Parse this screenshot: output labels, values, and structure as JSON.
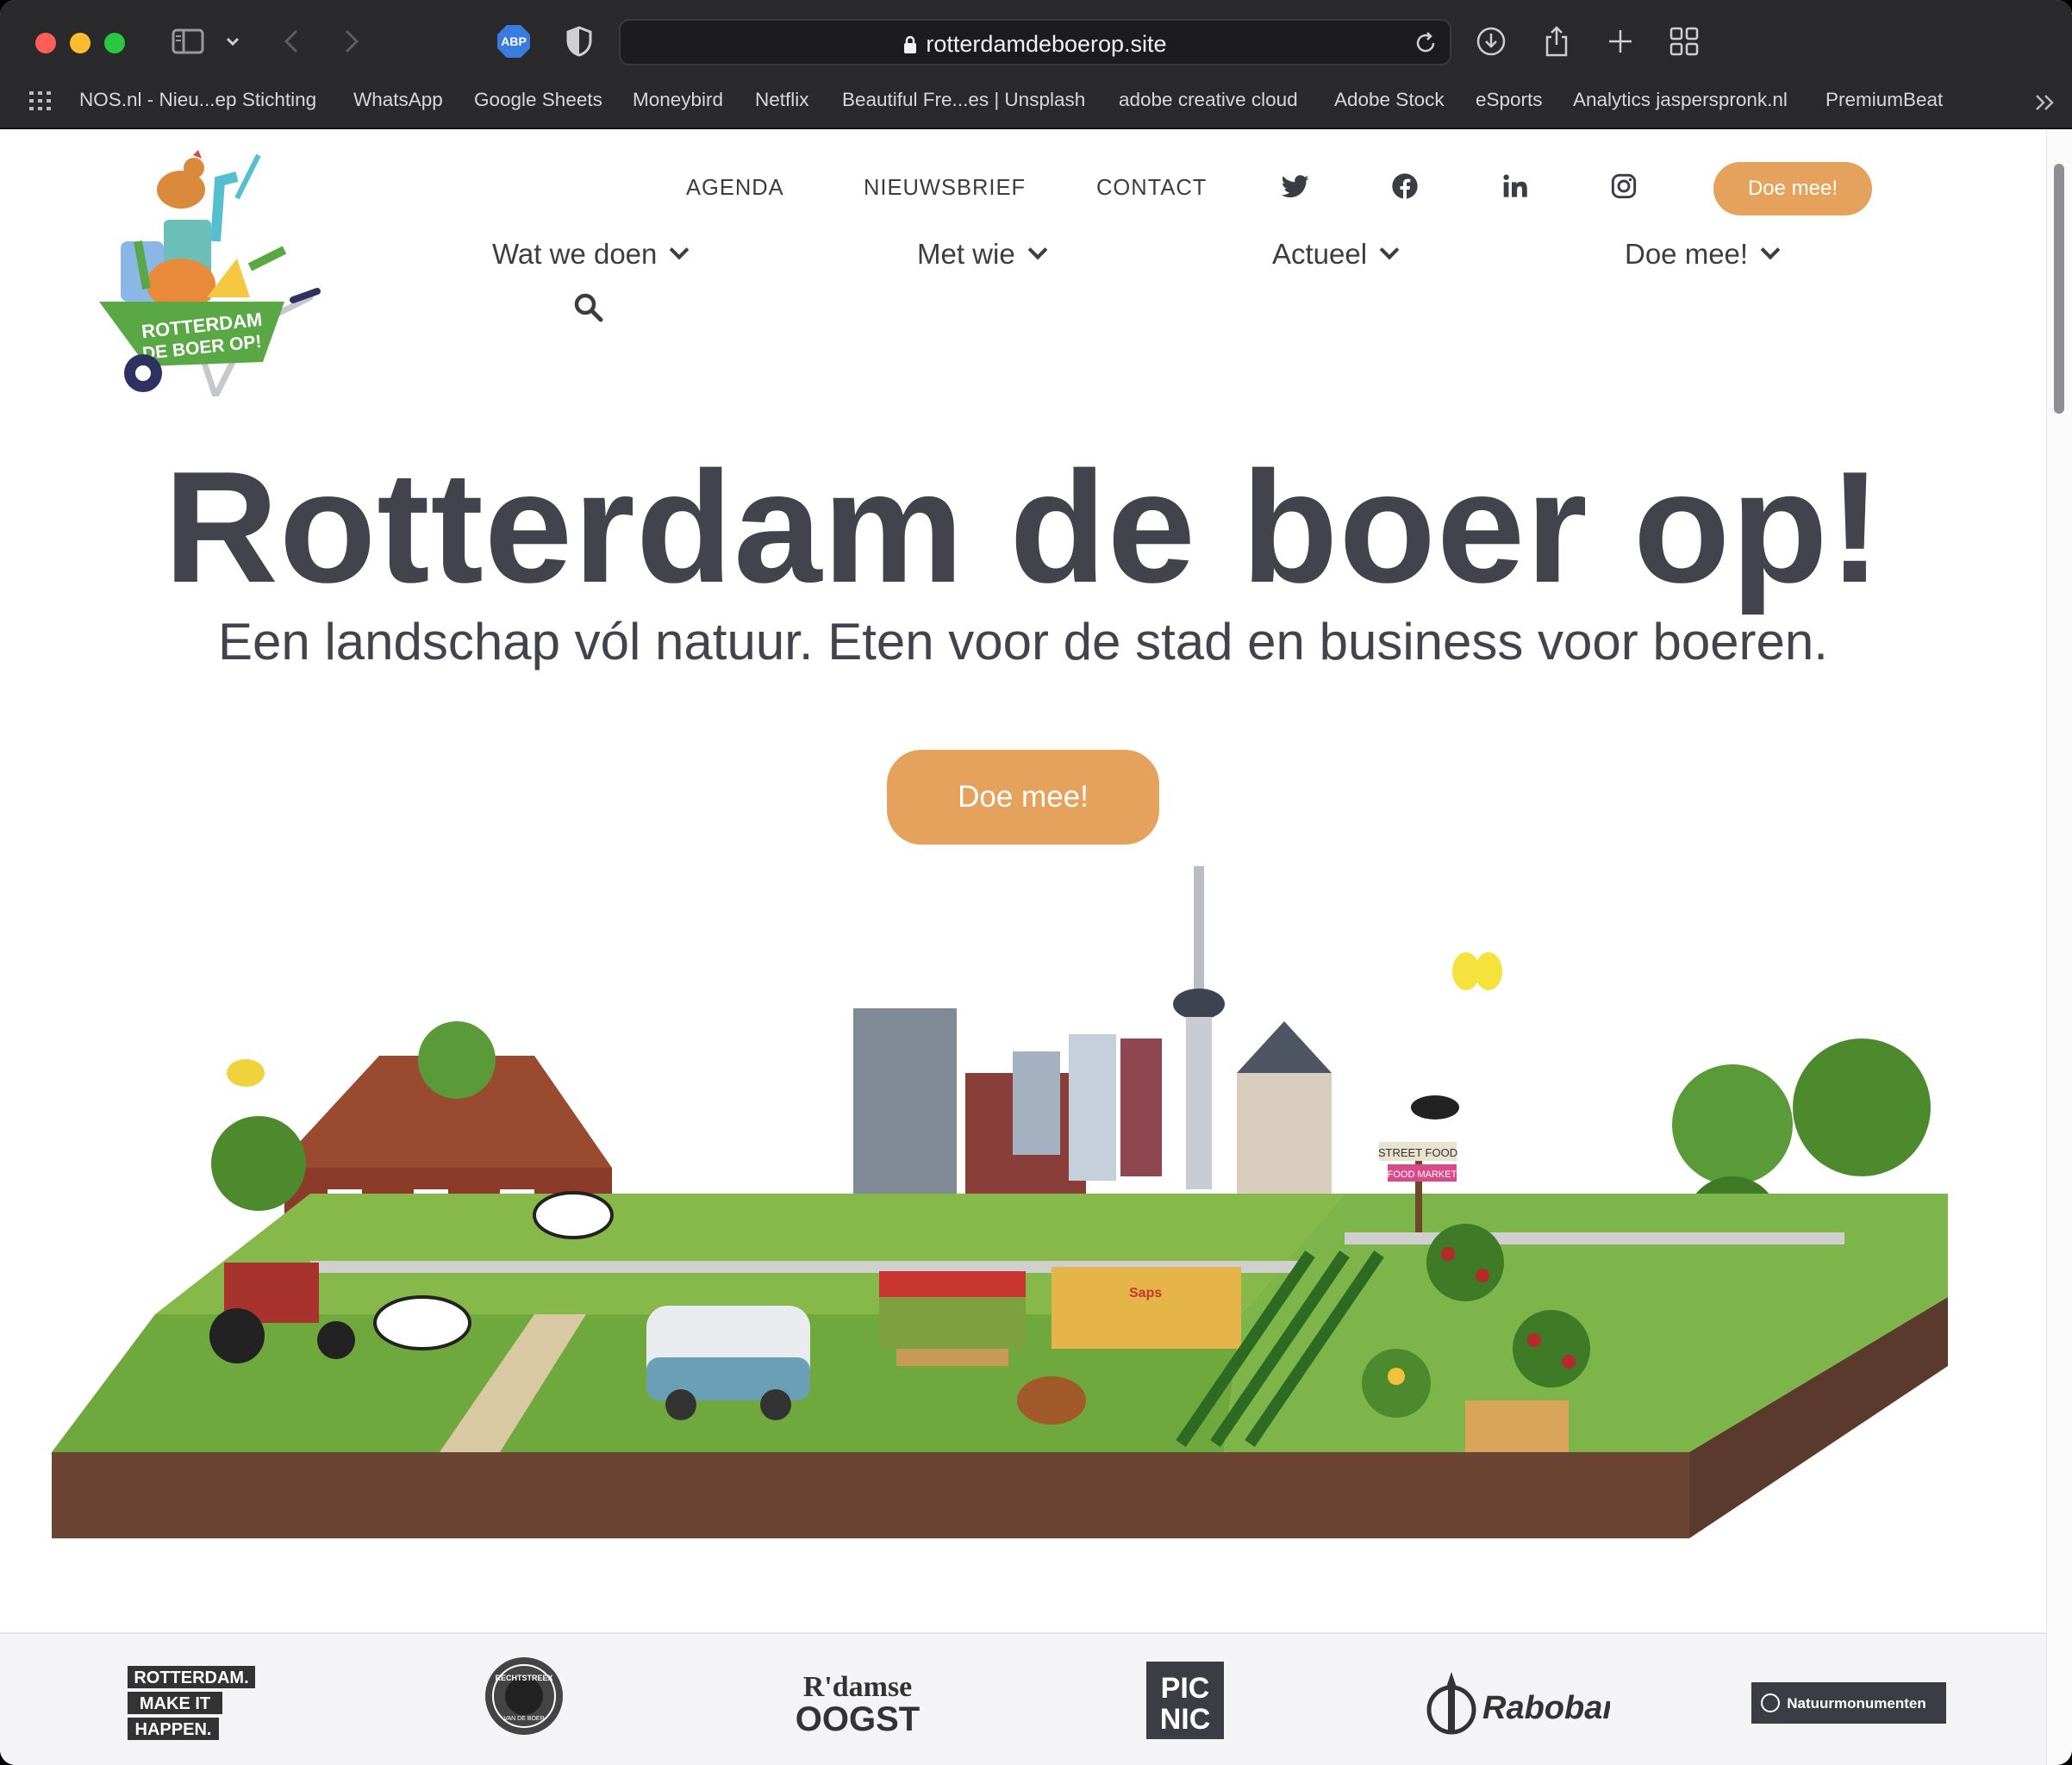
{
  "browser": {
    "url": "rotterdamdeboerop.site",
    "adblock_label": "ABP",
    "bookmarks": [
      "NOS.nl - Nieu...ep Stichting",
      "WhatsApp",
      "Google Sheets",
      "Moneybird",
      "Netflix",
      "Beautiful Fre...es | Unsplash",
      "adobe creative cloud",
      "Adobe Stock",
      "eSports",
      "Analytics jasperspronk.nl",
      "PremiumBeat"
    ]
  },
  "header": {
    "logo_text": "ROTTERDAM DE BOER OP!",
    "top_links": [
      "AGENDA",
      "NIEUWSBRIEF",
      "CONTACT"
    ],
    "social_icons": [
      "twitter-icon",
      "facebook-icon",
      "linkedin-icon",
      "instagram-icon"
    ],
    "cta_label": "Doe mee!",
    "main_menu": [
      "Wat we doen",
      "Met wie",
      "Actueel",
      "Doe mee!"
    ]
  },
  "hero": {
    "title": "Rotterdam de boer op!",
    "subtitle": "Een landschap vól natuur. Eten voor de stad en business voor boeren.",
    "cta_label": "Doe mee!",
    "illustration_signs": [
      "STREET FOOD",
      "FOOD MARKET"
    ],
    "truck_label": "Saps"
  },
  "partners": {
    "logos": [
      {
        "name": "rotterdam-make-it-happen-logo",
        "text": [
          "ROTTERDAM.",
          "MAKE IT",
          "HAPPEN."
        ]
      },
      {
        "name": "rechtstreex-logo",
        "text": [
          "RECHTSTREEX",
          "VAN DE BOER"
        ]
      },
      {
        "name": "rdamse-oogst-logo",
        "text": [
          "R'damse",
          "OOGST"
        ]
      },
      {
        "name": "picnic-logo",
        "text": [
          "PIC",
          "NIC"
        ]
      },
      {
        "name": "rabobank-logo",
        "text": [
          "Rabobank"
        ]
      },
      {
        "name": "natuurmonumenten-logo",
        "text": [
          "Natuurmonumenten"
        ]
      }
    ]
  },
  "colors": {
    "accent": "#e5a25d",
    "text": "#43434d",
    "chrome": "#2a2a2c",
    "logo_green": "#5aa845"
  }
}
